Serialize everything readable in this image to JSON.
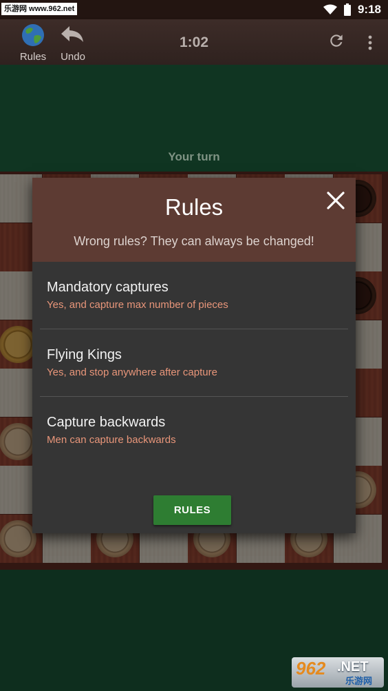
{
  "status_bar": {
    "watermark": "乐游网 www.962.net",
    "time": "9:18"
  },
  "app_bar": {
    "rules_label": "Rules",
    "undo_label": "Undo",
    "timer": "1:02",
    "icons": [
      "globe-icon",
      "undo-arrow-icon",
      "refresh-icon",
      "more-vert-icon"
    ]
  },
  "game": {
    "turn_text": "Your turn"
  },
  "dialog": {
    "title": "Rules",
    "subtitle": "Wrong rules? They can always be changed!",
    "rules": [
      {
        "title": "Mandatory captures",
        "value": "Yes, and capture max number of pieces"
      },
      {
        "title": "Flying Kings",
        "value": "Yes, and stop anywhere after capture"
      },
      {
        "title": "Capture backwards",
        "value": "Men can capture backwards"
      }
    ],
    "button_label": "RULES"
  },
  "watermark_bottom": {
    "big": "962",
    "net": ".NET",
    "cn": "乐游网"
  },
  "colors": {
    "accent_button": "#2e7d32",
    "rule_value": "#e9967a",
    "dialog_header": "#5d3b33"
  }
}
